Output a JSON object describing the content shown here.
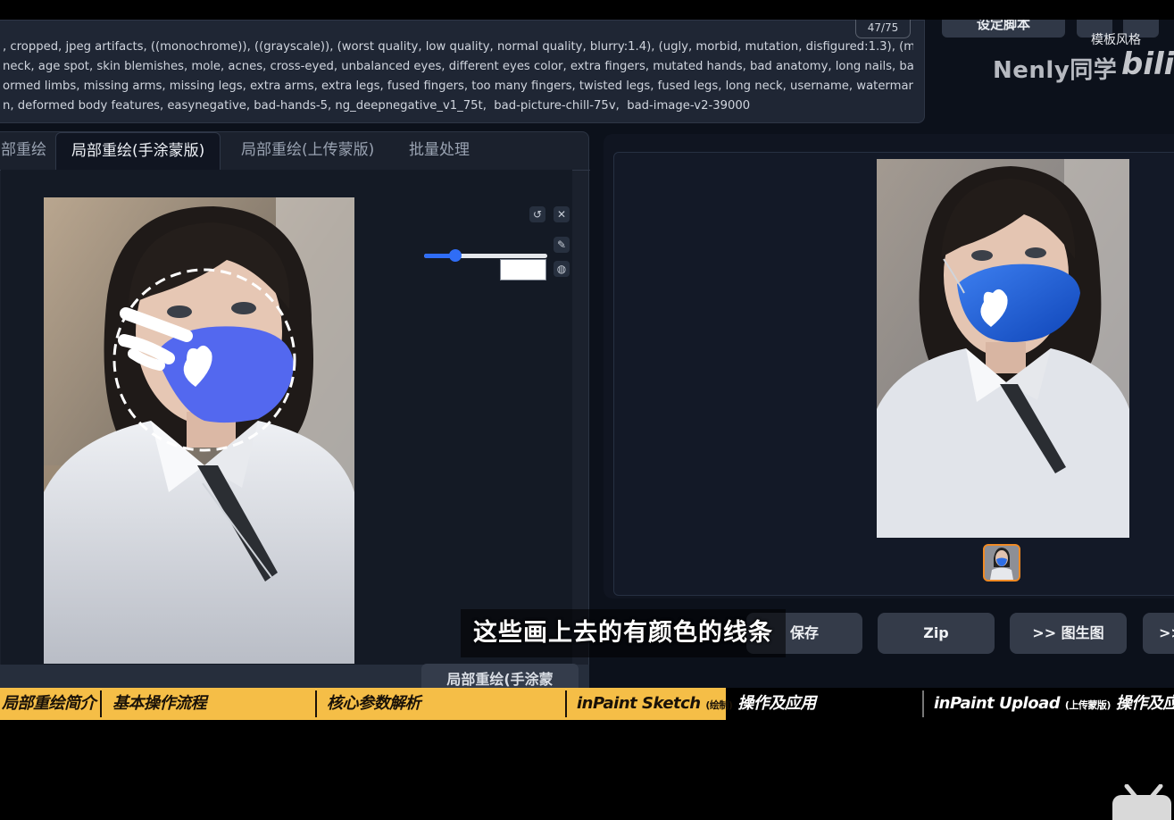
{
  "negative_prompt": {
    "lines": [
      ", cropped, jpeg artifacts, ((monochrome)), ((grayscale)), (worst quality, low quality, normal quality, blurry:1.4), (ugly, morbid, mutation, disfigured:1.3), (more than",
      "neck, age spot, skin blemishes, mole, acnes, cross-eyed, unbalanced eyes, different eyes color, extra fingers, mutated hands, bad anatomy, long nails, bad",
      "ormed limbs, missing arms, missing legs, extra arms, extra legs, fused fingers, too many fingers, twisted legs, fused legs, long neck, username, watermark, poor",
      "n, deformed body features, easynegative, bad-hands-5, ng_deepnegative_v1_75t,  bad-picture-chill-75v,  bad-image-v2-39000"
    ],
    "token_count": "47/75"
  },
  "top_right": {
    "button_label": "设定脚本",
    "style_label": "模板风格",
    "watermark": "Nenly同学",
    "bili": "bilil"
  },
  "tabs": [
    {
      "label": "部重绘"
    },
    {
      "label": "局部重绘(手涂蒙版)"
    },
    {
      "label": "局部重绘(上传蒙版)"
    },
    {
      "label": "批量处理"
    }
  ],
  "canvas_tools": {
    "undo_icon": "↺",
    "close_icon": "✕",
    "brush_icon": "✎",
    "color_icon": "◍",
    "brush_size": 0.25
  },
  "inpaint_button": "局部重绘(手涂蒙",
  "action_buttons": [
    {
      "label": "保存"
    },
    {
      "label": "Zip"
    },
    {
      "label": ">> 图生图"
    },
    {
      "label": ">>"
    }
  ],
  "subtitle": "这些画上去的有颜色的线条",
  "chapters": [
    {
      "label": "局部重绘简介"
    },
    {
      "label": "基本操作流程"
    },
    {
      "label": "核心参数解析"
    },
    {
      "label": "inPaint Sketch",
      "small": "(绘制)",
      "suffix": "操作及应用"
    },
    {
      "label": "inPaint Upload",
      "small": "(上传蒙版)",
      "suffix": "操作及应用"
    }
  ],
  "colors": {
    "accent": "#2f6df6",
    "chapter_bar": "#f5be47",
    "mask_blue": "#5368ef",
    "thumb_border": "#f08a24"
  }
}
